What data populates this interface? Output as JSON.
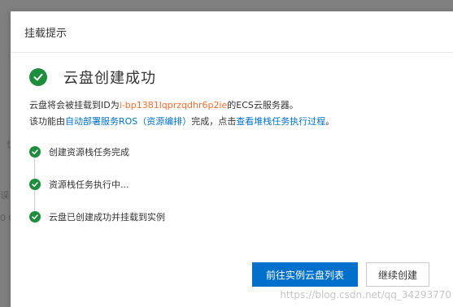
{
  "modal": {
    "title": "挂载提示",
    "success_title": "云盘创建成功",
    "desc_line1": {
      "prefix": "云盘将会被挂载到ID为",
      "instance_id": "i-bp1381lqprzqdhr6p2ie",
      "suffix": "的ECS云服务器。"
    },
    "desc_line2": {
      "prefix": "该功能由",
      "ros_link": "自动部署服务ROS（资源编排）",
      "middle": "完成，点击",
      "progress_link": "查看堆栈任务执行过程",
      "suffix": "。"
    },
    "steps": [
      {
        "label": "创建资源栈任务完成"
      },
      {
        "label": "资源栈任务执行中..."
      },
      {
        "label": "云盘已创建成功并挂载到实例"
      }
    ],
    "primary_button": "前往实例云盘列表",
    "secondary_button": "继续创建"
  },
  "backdrop": {
    "frag1": "信",
    "frag2": "误",
    "frag3": "0 G"
  },
  "watermark": "https://blog.csdn.net/qq_34293770",
  "colors": {
    "success": "#1e8e3e",
    "primary": "#0070cc",
    "highlight": "#f56c2d"
  }
}
